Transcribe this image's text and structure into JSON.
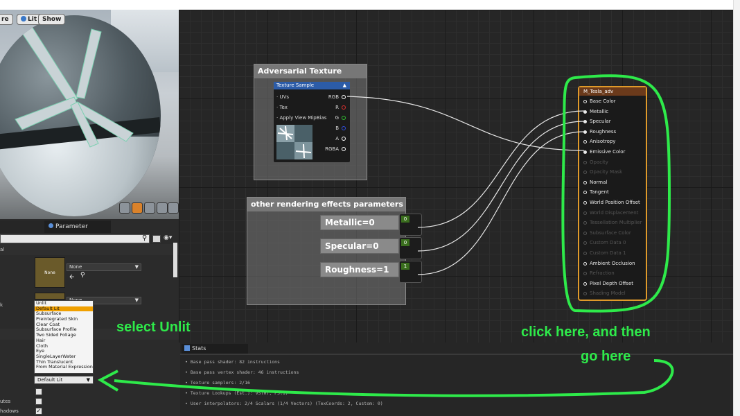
{
  "viewport": {
    "buttons": [
      "re",
      "Lit",
      "Show"
    ]
  },
  "details": {
    "tab_label": "Parameter Defaults",
    "texture_slot_1": "None",
    "texture_slot_2": "None",
    "swatch_label": "None",
    "shading_model_options": [
      "Unlit",
      "Default Lit",
      "Subsurface",
      "Preintegrated Skin",
      "Clear Coat",
      "Subsurface Profile",
      "Two Sided Foliage",
      "Hair",
      "Cloth",
      "Eye",
      "SingleLayerWater",
      "Thin Translucent",
      "From Material Expression"
    ],
    "shading_model_selected_highlight": "Default Lit",
    "shading_model_value": "Default Lit",
    "side_labels": [
      "al",
      "k",
      "utes",
      "hadows"
    ]
  },
  "graph": {
    "adversarial_comment_title": "Adversarial Texture",
    "texture_node_title": "Texture Sample",
    "texture_inputs": [
      "UVs",
      "Tex",
      "Apply View MipBias"
    ],
    "texture_outputs": [
      "RGB",
      "R",
      "G",
      "B",
      "A",
      "RGBA"
    ],
    "texture_output_colors": [
      "#ffffff",
      "#e03030",
      "#30c030",
      "#3050e0",
      "#ffffff",
      "#ffffff"
    ],
    "other_comment_title": "other rendering effects parameters",
    "params": [
      {
        "label": "Metallic=0",
        "value": "0"
      },
      {
        "label": "Specular=0",
        "value": "0"
      },
      {
        "label": "Roughness=1",
        "value": "1"
      }
    ],
    "material_node_title": "M_Tesla_adv",
    "material_inputs": [
      {
        "label": "Base Color",
        "active": true
      },
      {
        "label": "Metallic",
        "active": true
      },
      {
        "label": "Specular",
        "active": true
      },
      {
        "label": "Roughness",
        "active": true
      },
      {
        "label": "Anisotropy",
        "active": true
      },
      {
        "label": "Emissive Color",
        "active": true
      },
      {
        "label": "Opacity",
        "active": false
      },
      {
        "label": "Opacity Mask",
        "active": false
      },
      {
        "label": "Normal",
        "active": true
      },
      {
        "label": "Tangent",
        "active": true
      },
      {
        "label": "World Position Offset",
        "active": true
      },
      {
        "label": "World Displacement",
        "active": false
      },
      {
        "label": "Tessellation Multiplier",
        "active": false
      },
      {
        "label": "Subsurface Color",
        "active": false
      },
      {
        "label": "Custom Data 0",
        "active": false
      },
      {
        "label": "Custom Data 1",
        "active": false
      },
      {
        "label": "Ambient Occlusion",
        "active": true
      },
      {
        "label": "Refraction",
        "active": false
      },
      {
        "label": "Pixel Depth Offset",
        "active": true
      },
      {
        "label": "Shading Model",
        "active": false
      }
    ]
  },
  "stats": {
    "tab_label": "Stats",
    "lines": [
      "• Base pass shader: 82 instructions",
      "• Base pass vertex shader: 46 instructions",
      "• Texture samplers: 2/16",
      "• Texture Lookups (Est.): VS(0), PS(1)",
      "• User interpolators: 2/4 Scalars (1/4 Vectors) (TexCoords: 2, Custom: 0)"
    ]
  },
  "annotations": {
    "select_unlit": "select Unlit",
    "click_here_line1": "click here, and then",
    "click_here_line2": "go here"
  },
  "colors": {
    "annotation_green": "#2eea4a",
    "material_border": "#e09a2a",
    "highlight_orange": "#f0a000"
  }
}
